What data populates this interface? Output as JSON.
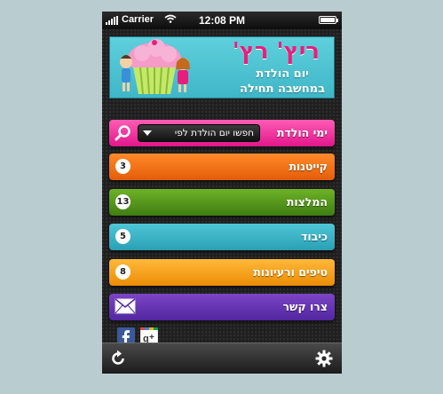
{
  "status_bar": {
    "carrier": "Carrier",
    "time": "12:08 PM"
  },
  "banner": {
    "title": "ריץ' רץ'",
    "subtitle_line1": "יום הולדת",
    "subtitle_line2": "במחשבה תחילה"
  },
  "menu": {
    "birthdays": {
      "label": "ימי הולדת",
      "search_dropdown": "חפשו יום הולדת לפי",
      "color": "#e0168b"
    },
    "items": [
      {
        "label": "קייטנות",
        "count": "3",
        "color": "#e45d08"
      },
      {
        "label": "המלצות",
        "count": "13",
        "color": "#3f7d12"
      },
      {
        "label": "כיבוד",
        "count": "5",
        "color": "#2aa0b4"
      },
      {
        "label": "טיפים ורעיונות",
        "count": "8",
        "color": "#ec8c06"
      }
    ],
    "contact": {
      "label": "צרו קשר",
      "color": "#5227a0"
    }
  },
  "social": {
    "facebook_icon": "facebook-icon",
    "googleplus_icon": "google-plus-icon"
  },
  "toolbar": {
    "refresh_icon": "refresh-icon",
    "settings_icon": "gear-icon"
  }
}
